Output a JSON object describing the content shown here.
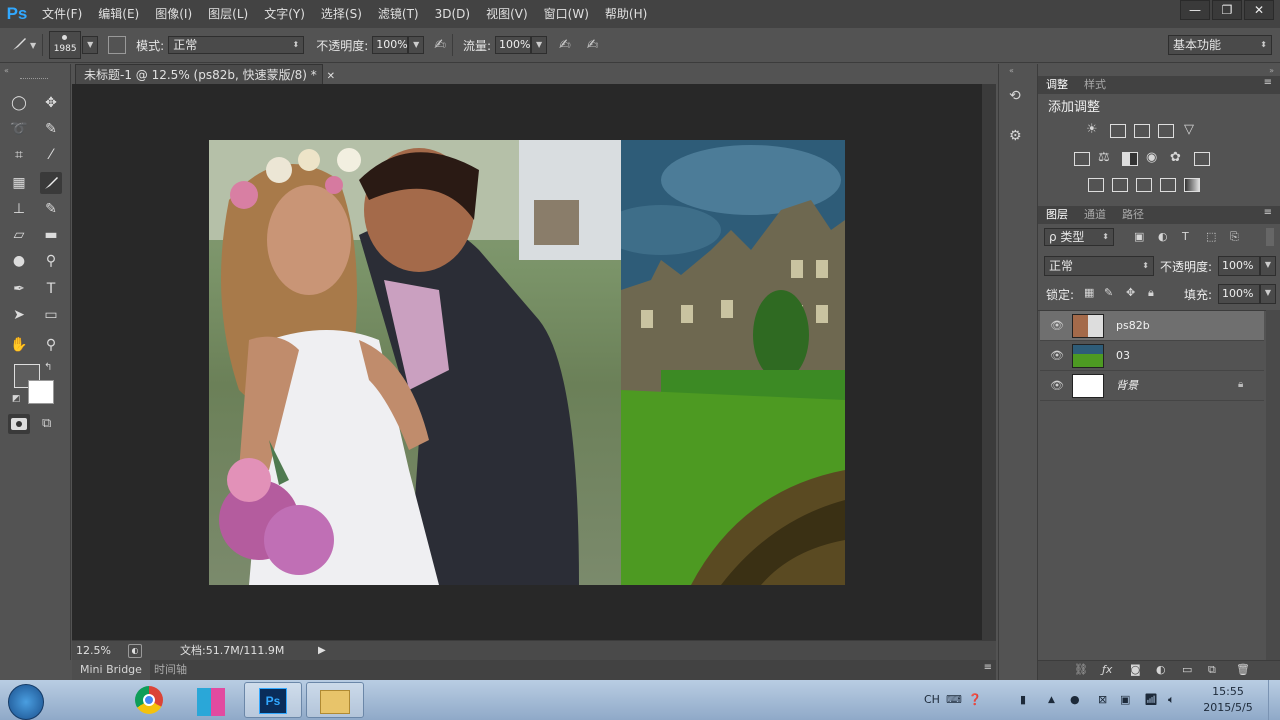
{
  "app": {
    "logo": "Ps"
  },
  "menu": [
    "文件(F)",
    "编辑(E)",
    "图像(I)",
    "图层(L)",
    "文字(Y)",
    "选择(S)",
    "滤镜(T)",
    "3D(D)",
    "视图(V)",
    "窗口(W)",
    "帮助(H)"
  ],
  "window_buttons": {
    "minimize": "—",
    "restore": "❐",
    "close": "✕"
  },
  "options": {
    "brush_size": "1985",
    "mode_label": "模式:",
    "mode_value": "正常",
    "opacity_label": "不透明度:",
    "opacity_value": "100%",
    "flow_label": "流量:",
    "flow_value": "100%",
    "workspace": "基本功能"
  },
  "document": {
    "tab_title": "未标题-1 @ 12.5% (ps82b, 快速蒙版/8) *",
    "zoom": "12.5%",
    "doc_size": "文档:51.7M/111.9M"
  },
  "bottom_tabs": [
    "Mini Bridge",
    "时间轴"
  ],
  "adjustments": {
    "tabs": [
      "调整",
      "样式"
    ],
    "title": "添加调整"
  },
  "layers_panel": {
    "tabs": [
      "图层",
      "通道",
      "路径"
    ],
    "filter_label": "ρ 类型",
    "blend_mode": "正常",
    "opacity_label": "不透明度:",
    "opacity_value": "100%",
    "lock_label": "锁定:",
    "fill_label": "填充:",
    "fill_value": "100%",
    "layers": [
      {
        "name": "ps82b",
        "selected": true
      },
      {
        "name": "03",
        "selected": false
      },
      {
        "name": "背景",
        "selected": false
      }
    ]
  },
  "taskbar": {
    "lang": "CH",
    "time": "15:55",
    "date": "2015/5/5",
    "ps_label": "Ps"
  }
}
